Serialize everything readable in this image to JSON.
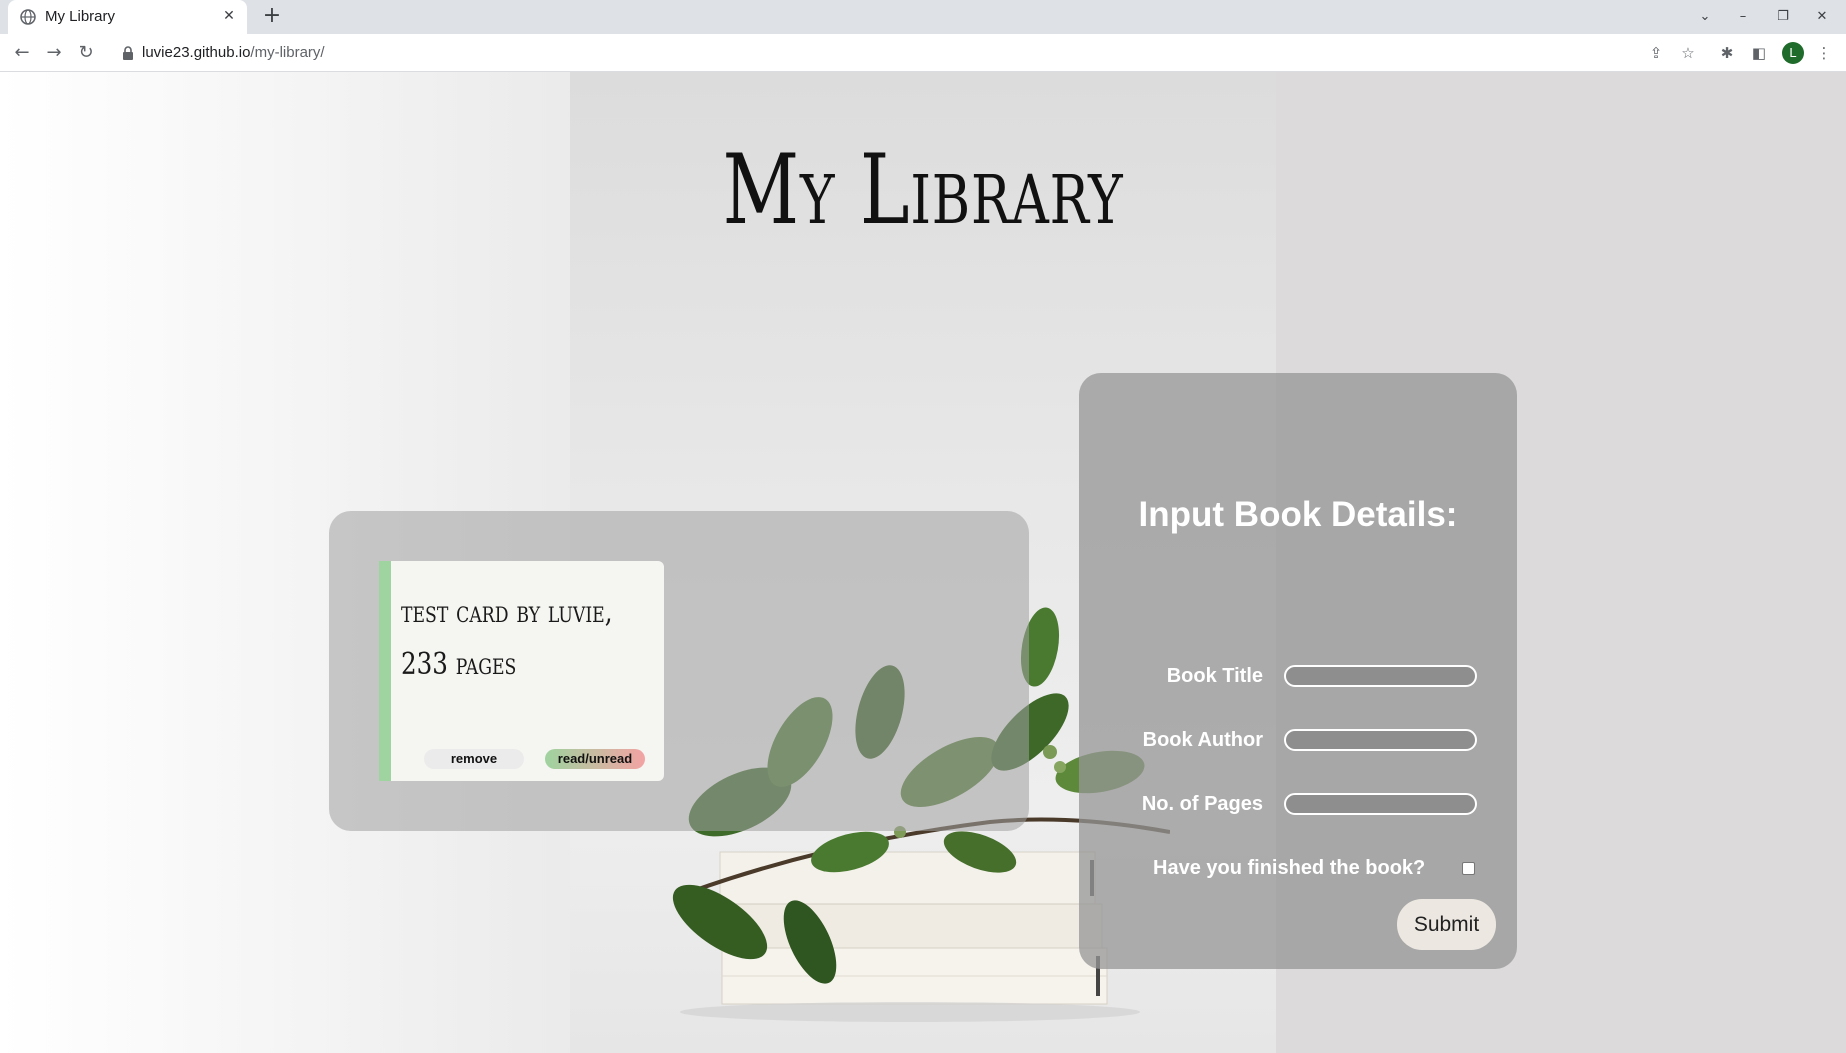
{
  "browser": {
    "tab_title": "My Library",
    "tab_close": "✕",
    "new_tab": "+",
    "url_host": "luvie23.github.io",
    "url_path": "/my-library/",
    "profile_initial": "L"
  },
  "page": {
    "title": "My Library"
  },
  "library": {
    "cards": [
      {
        "text_line1": "test card by luvie,",
        "text_line2": "233 pages",
        "remove_label": "remove",
        "toggle_label": "read/unread"
      }
    ]
  },
  "form": {
    "heading": "Input Book Details:",
    "title_label": "Book Title",
    "title_value": "",
    "author_label": "Book Author",
    "author_value": "",
    "pages_label": "No. of Pages",
    "pages_value": "",
    "finished_label": "Have you finished the book?",
    "finished_checked": false,
    "submit_label": "Submit"
  },
  "colors": {
    "read_status_stripe": "#9fd39f",
    "unread_accent": "#f2a3a3",
    "avatar": "#1e6b2b"
  }
}
